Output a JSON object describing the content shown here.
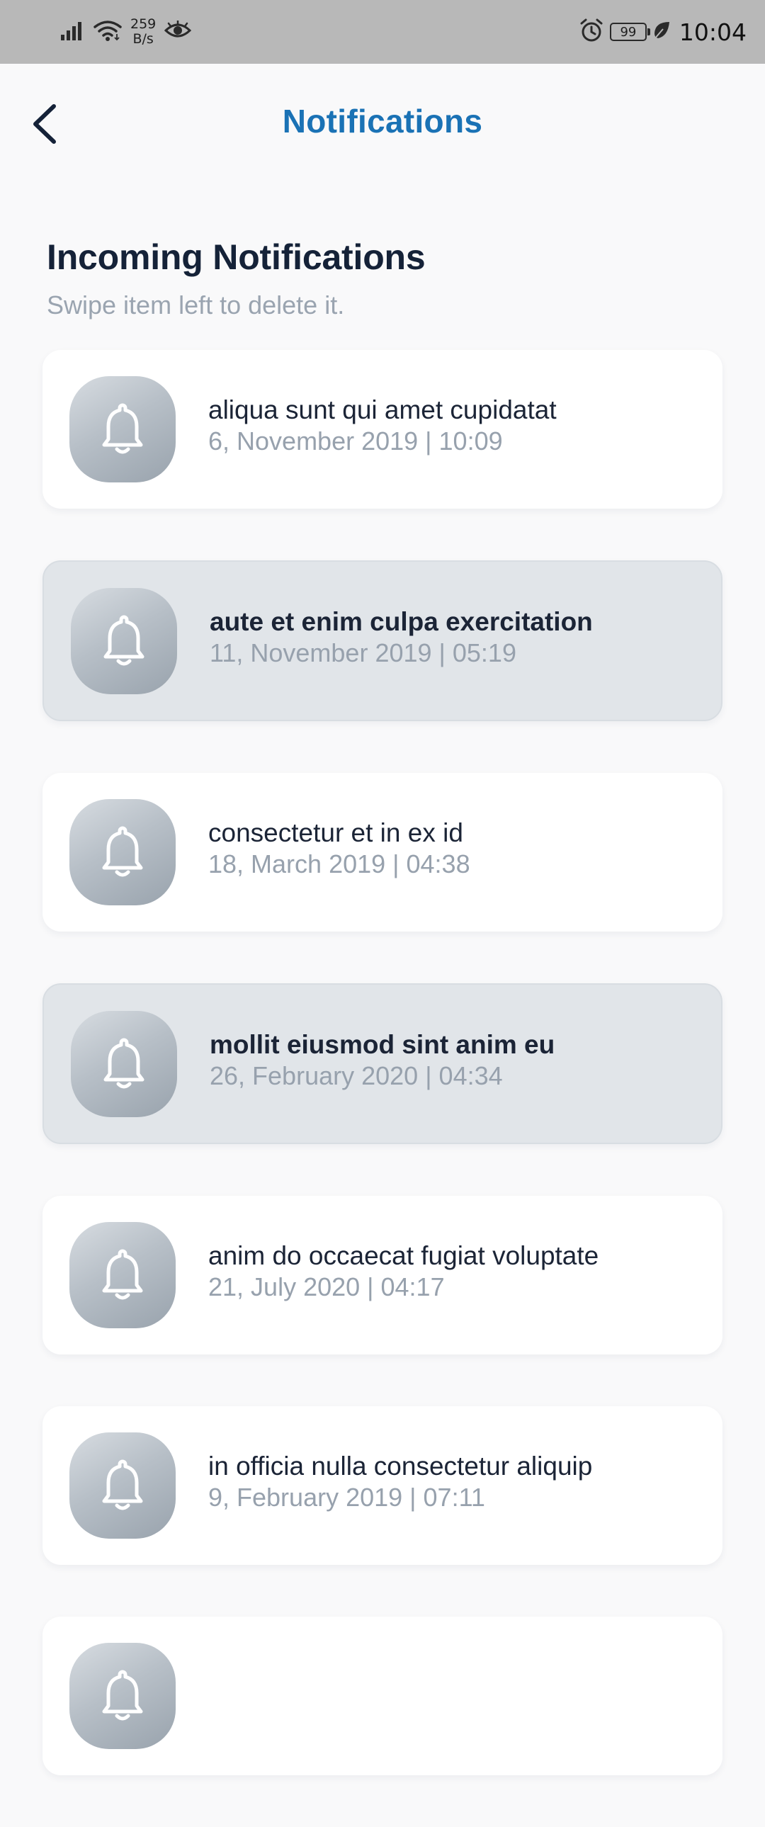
{
  "status_bar": {
    "net_speed_value": "259",
    "net_speed_unit": "B/s",
    "battery": "99",
    "time": "10:04"
  },
  "header": {
    "title": "Notifications"
  },
  "section": {
    "title": "Incoming Notifications",
    "subtitle": "Swipe item left to delete it."
  },
  "notifications": [
    {
      "title": "aliqua sunt qui amet cupidatat",
      "date": "6, November 2019 | 10:09",
      "unread": false
    },
    {
      "title": "aute et enim culpa exercitation",
      "date": "11, November 2019 | 05:19",
      "unread": true
    },
    {
      "title": "consectetur et in ex id",
      "date": "18, March 2019 | 04:38",
      "unread": false
    },
    {
      "title": "mollit eiusmod sint anim eu",
      "date": "26, February 2020 | 04:34",
      "unread": true
    },
    {
      "title": "anim do occaecat fugiat voluptate",
      "date": "21, July 2020 | 04:17",
      "unread": false
    },
    {
      "title": "in officia nulla consectetur aliquip",
      "date": "9, February 2019 | 07:11",
      "unread": false
    },
    {
      "title": "",
      "date": "",
      "unread": false
    }
  ],
  "colors": {
    "accent": "#1a72b5",
    "heading": "#152238",
    "muted": "#97a1ad",
    "unread_bg": "#e1e5e9",
    "status_bar_bg": "#b8b8b8"
  },
  "icons": {
    "back": "chevron-left-icon",
    "notification": "bell-icon"
  }
}
